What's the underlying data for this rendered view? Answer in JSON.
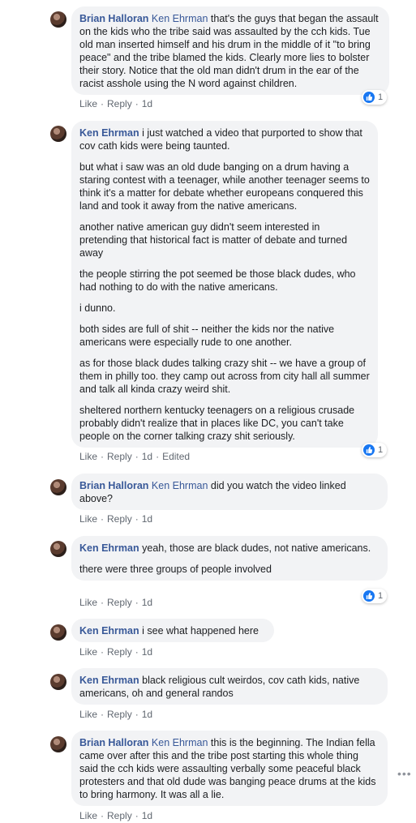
{
  "actions": {
    "like": "Like",
    "reply": "Reply",
    "edited": "Edited"
  },
  "comments": [
    {
      "author": "Brian Halloran",
      "tag": "Ken Ehrman",
      "time": "1d",
      "reactions": "1",
      "paragraphs": [
        "that's the guys that began the assault on the kids who the tribe said was assaulted by the cch kids. Tue old man inserted himself and his drum in the middle of it \"to bring peace\" and the tribe blamed the kids. Clearly more lies to bolster their story. Notice that the old man didn't drum in the ear of the racist asshole using the N word against children."
      ]
    },
    {
      "author": "Ken Ehrman",
      "tag": "",
      "time": "1d",
      "reactions": "1",
      "paragraphs": [
        "i just watched a video that purported to show that cov cath kids were being taunted.",
        "but what i saw was an old dude banging on a drum having a staring contest with a teenager, while another teenager seems to think it's a matter for debate whether europeans conquered this land and took it away from the native americans.",
        "another native american guy didn't seem interested in pretending that historical fact is matter of debate and turned away",
        "the people stirring the pot seemed be those black dudes, who had nothing to do with the native americans.",
        "i dunno.",
        "both sides are full of shit -- neither the kids nor the native americans were especially rude to one another.",
        "as for those black dudes talking crazy shit -- we have a group of them in philly too. they camp out across from city hall all summer and talk all kinda crazy weird shit.",
        "sheltered northern kentucky teenagers on a religious crusade probably didn't realize that in places like DC, you can't take people on the corner talking crazy shit seriously."
      ]
    },
    {
      "author": "Brian Halloran",
      "tag": "Ken Ehrman",
      "time": "1d",
      "reactions": "",
      "paragraphs": [
        "did you watch the video linked above?"
      ]
    },
    {
      "author": "Ken Ehrman",
      "tag": "",
      "time": "1d",
      "reactions": "1",
      "paragraphs": [
        "yeah, those are black dudes, not native americans.",
        "there were three groups of people involved"
      ]
    },
    {
      "author": "Ken Ehrman",
      "tag": "",
      "time": "1d",
      "reactions": "",
      "paragraphs": [
        "i see what happened here"
      ]
    },
    {
      "author": "Ken Ehrman",
      "tag": "",
      "time": "1d",
      "reactions": "",
      "paragraphs": [
        "black religious cult weirdos, cov cath kids, native americans, oh and general randos"
      ]
    },
    {
      "author": "Brian Halloran",
      "tag": "Ken Ehrman",
      "time": "1d",
      "reactions": "",
      "paragraphs": [
        "this is the beginning. The Indian fella came over after this and the tribe post starting this whole thing said the cch kids were assaulting verbally some peaceful black protesters and that old dude was banging peace drums at the kids to bring harmony. It was all a lie."
      ]
    }
  ],
  "more_label": "•••"
}
